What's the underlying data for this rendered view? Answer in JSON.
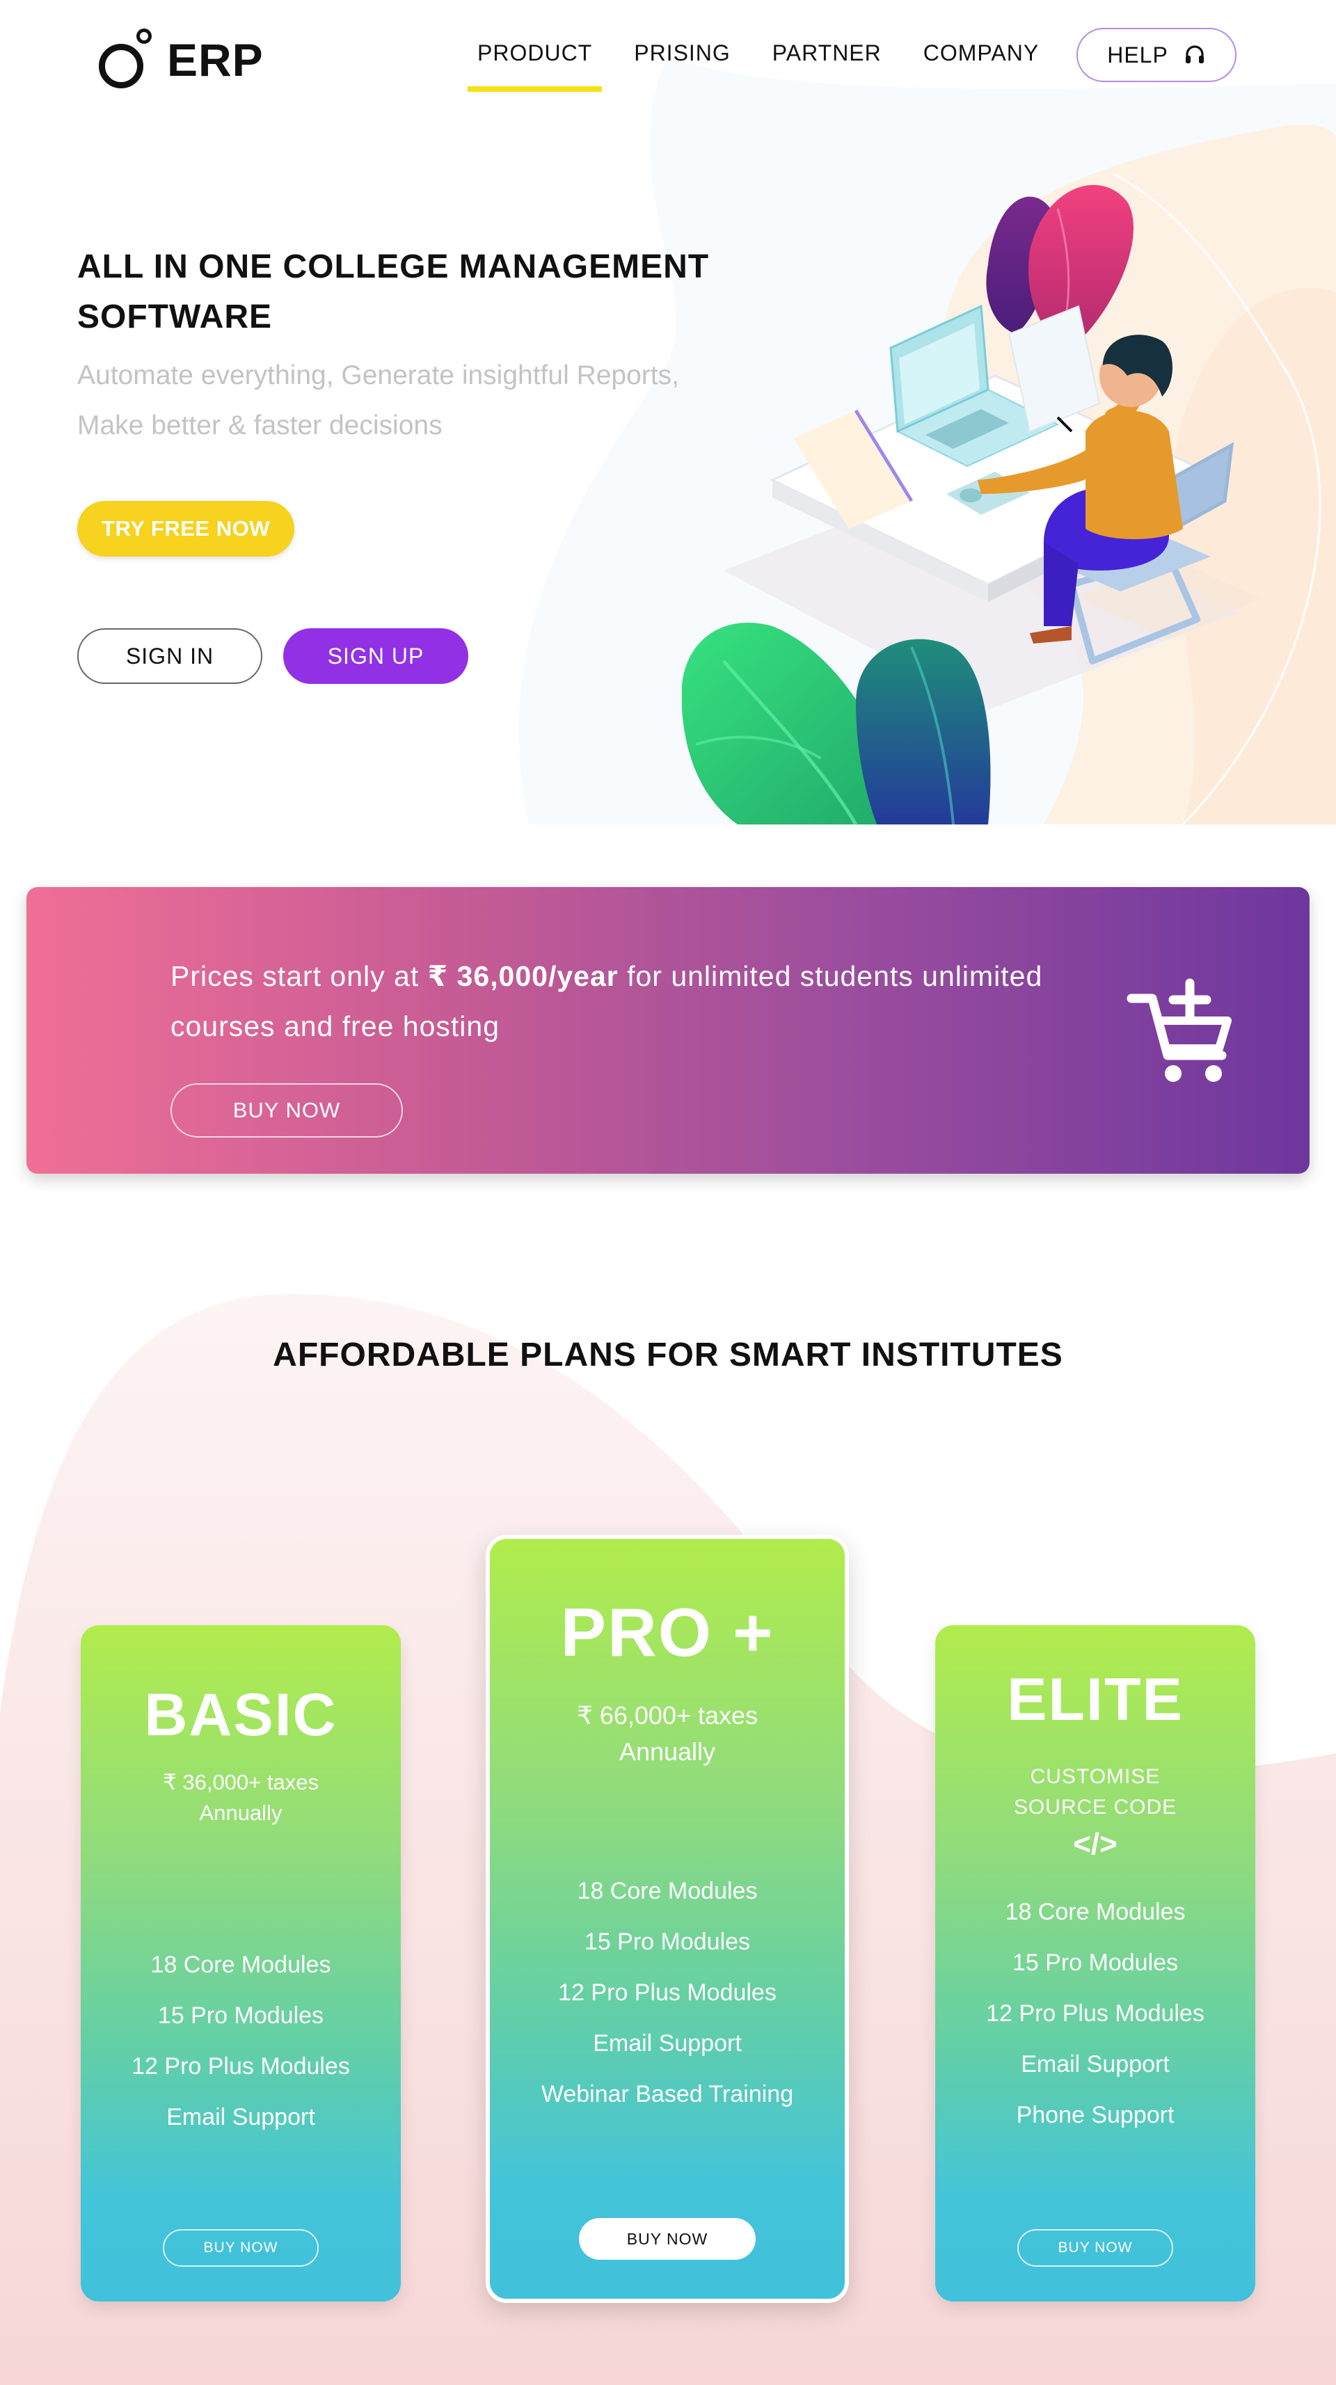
{
  "brand": {
    "logo_text": "ERP"
  },
  "nav": {
    "items": [
      {
        "label": "PRODUCT",
        "active": true
      },
      {
        "label": "PRISING",
        "active": false
      },
      {
        "label": "PARTNER",
        "active": false
      },
      {
        "label": "COMPANY",
        "active": false
      }
    ],
    "help_label": "HELP",
    "help_icon": "headset-icon",
    "active_underline_color": "#f5e015"
  },
  "hero": {
    "title": "ALL IN ONE COLLEGE MANAGEMENT SOFTWARE",
    "subtitle": "Automate everything, Generate insightful Reports, Make better & faster decisions",
    "try_label": "TRY FREE NOW",
    "signin_label": "SIGN IN",
    "signup_label": "SIGN UP",
    "colors": {
      "try": "#f7d21e",
      "signup": "#9230e6"
    }
  },
  "promo": {
    "text_before": "Prices start only at ",
    "price": "₹ 36,000/year",
    "text_after": " for unlimited students unlimited courses and free hosting",
    "buy_label": "BUY NOW",
    "icon": "add-to-cart-icon"
  },
  "plans": {
    "title": "AFFORDABLE PLANS FOR SMART INSTITUTES",
    "basic": {
      "name": "BASIC",
      "price_line1": "₹ 36,000+ taxes",
      "price_line2": "Annually",
      "features": [
        "18 Core Modules",
        "15 Pro Modules",
        "12 Pro Plus Modules",
        "Email Support"
      ],
      "buy_label": "BUY NOW"
    },
    "pro": {
      "name": "PRO +",
      "price_line1": "₹ 66,000+ taxes",
      "price_line2": "Annually",
      "features": [
        "18 Core Modules",
        "15 Pro Modules",
        "12 Pro Plus Modules",
        "Email Support",
        "Webinar Based Training"
      ],
      "buy_label": "BUY NOW"
    },
    "elite": {
      "name": "ELITE",
      "custom_line1": "CUSTOMISE",
      "custom_line2": "SOURCE CODE",
      "code_symbol": "</>",
      "features": [
        "18 Core Modules",
        "15 Pro Modules",
        "12 Pro Plus Modules",
        "Email Support",
        "Phone Support"
      ],
      "buy_label": "BUY NOW"
    }
  }
}
